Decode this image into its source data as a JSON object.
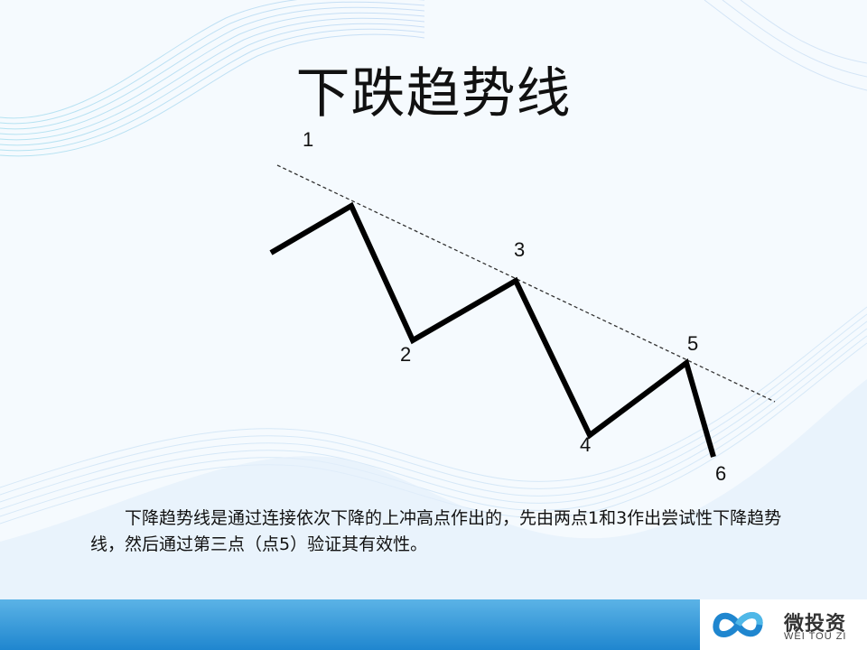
{
  "title": "下跌趋势线",
  "diagram": {
    "point_labels": [
      "1",
      "2",
      "3",
      "4",
      "5",
      "6"
    ]
  },
  "description": "下降趋势线是通过连接依次下降的上冲高点作出的，先由两点1和3作出尝试性下降趋势线，然后通过第三点（点5）验证其有效性。",
  "logo": {
    "name_cn": "微投资",
    "name_en": "WEI TOU ZI",
    "colors": {
      "blue": "#1f86cf",
      "light_blue": "#4fb8e8",
      "teal": "#2aa6c9"
    }
  }
}
